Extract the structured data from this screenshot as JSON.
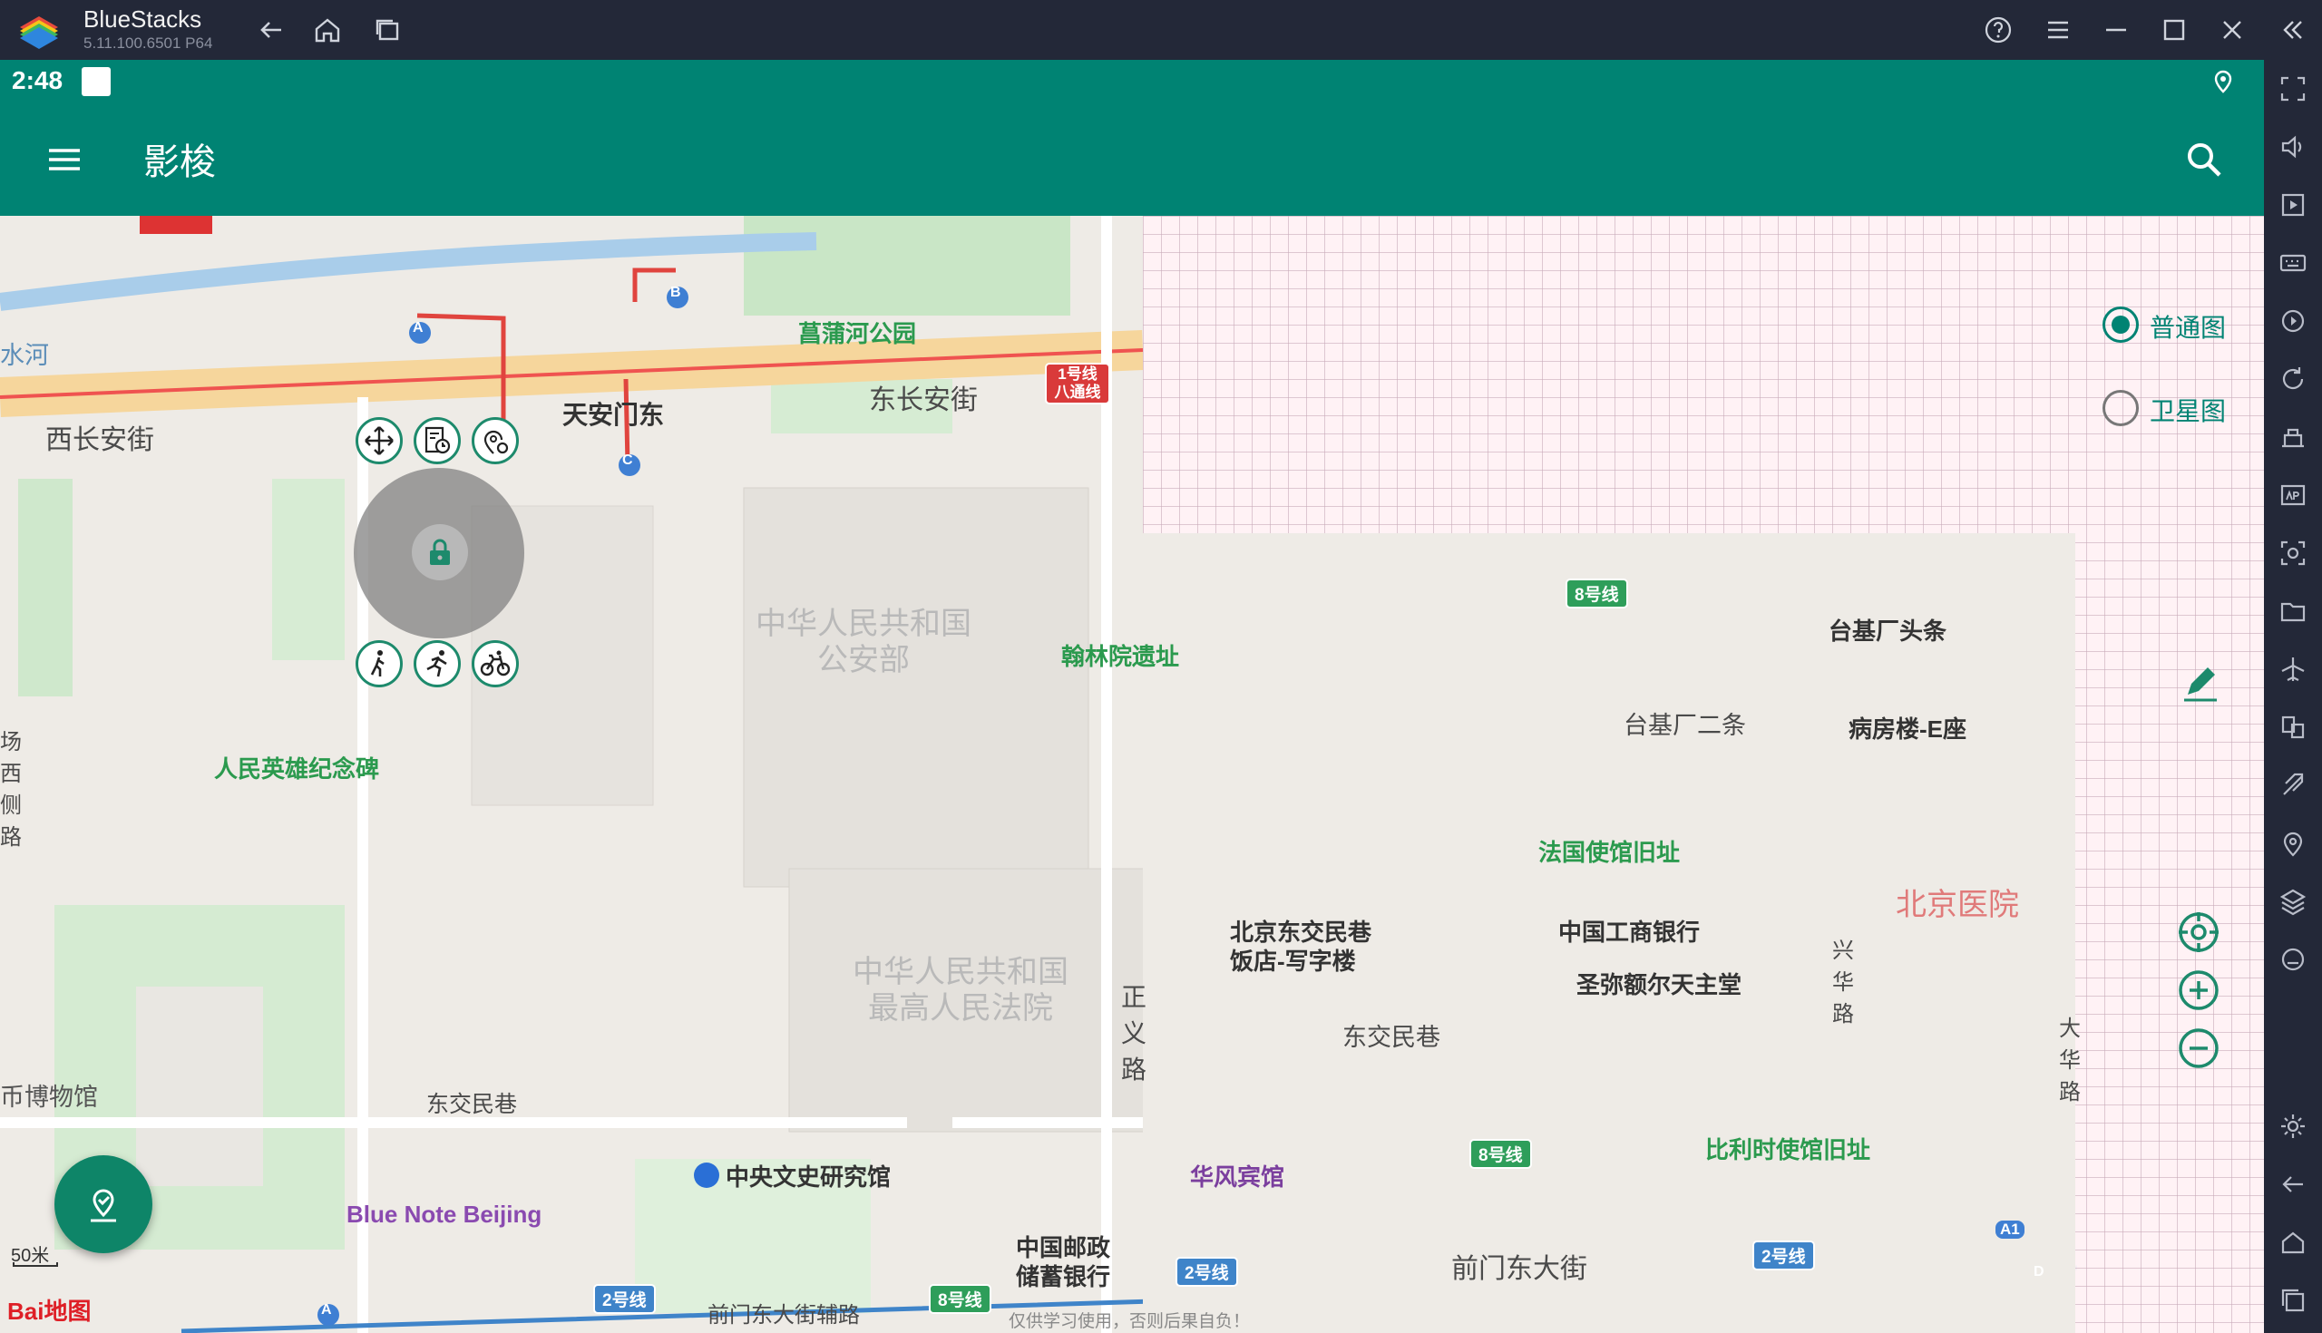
{
  "window": {
    "app_name": "BlueStacks",
    "version": "5.11.100.6501 P64"
  },
  "status_bar": {
    "time": "2:48"
  },
  "app_bar": {
    "title": "影梭"
  },
  "map_type": {
    "options": [
      "普通图",
      "卫星图"
    ],
    "selected": "普通图"
  },
  "map": {
    "roads": [
      "西长安街",
      "东长安街",
      "东交民巷",
      "东交民巷",
      "台基厂二条",
      "前门东大街",
      "前门东大街辅路"
    ],
    "road_vertical": [
      "正义路",
      "兴华路",
      "大华路",
      "场西侧路"
    ],
    "water": [
      "水河"
    ],
    "landmarks_green": [
      "菖蒲河公园",
      "人民英雄纪念碑",
      "翰林院遗址",
      "法国使馆旧址",
      "比利时使馆旧址"
    ],
    "landmarks_blue": [
      "天安门东",
      "台基厂头条",
      "病房楼-E座",
      "中国工商银行",
      "圣弥额尔天主堂",
      "北京东交民巷饭店-写字楼",
      "中央文史研究馆",
      "华风宾馆",
      "中国邮政储蓄银行"
    ],
    "buildings": [
      "中华人民共和国公安部",
      "中华人民共和国最高人民法院",
      "北京医院"
    ],
    "other_places": [
      "币博物馆",
      "Blue Note Beijing"
    ],
    "metro": [
      "1号线 八通线",
      "8号线",
      "8号线",
      "8号线",
      "2号线",
      "2号线",
      "2号线"
    ],
    "exits": [
      "A",
      "B",
      "C",
      "A",
      "A1",
      "D"
    ],
    "scale": "50米",
    "logo": "Bai地图",
    "disclaimer": "仅供学习使用，否则后果自负！"
  },
  "colors": {
    "accent": "#008373",
    "bluestacks_bar": "#232838",
    "metro_green": "#2e9e5a",
    "metro_blue": "#3f84c9"
  },
  "icons": {
    "titlebar": [
      "back-icon",
      "home-icon",
      "multi-window-icon",
      "help-icon",
      "menu-icon",
      "minimize-icon",
      "maximize-icon",
      "close-icon",
      "collapse-sidebar-icon"
    ],
    "joystick_top": [
      "move-icon",
      "history-icon",
      "location-settings-icon"
    ],
    "joystick_bottom": [
      "walk-icon",
      "run-icon",
      "bike-icon"
    ],
    "map_controls": [
      "edit-icon",
      "locate-icon",
      "zoom-in-icon",
      "zoom-out-icon"
    ]
  }
}
